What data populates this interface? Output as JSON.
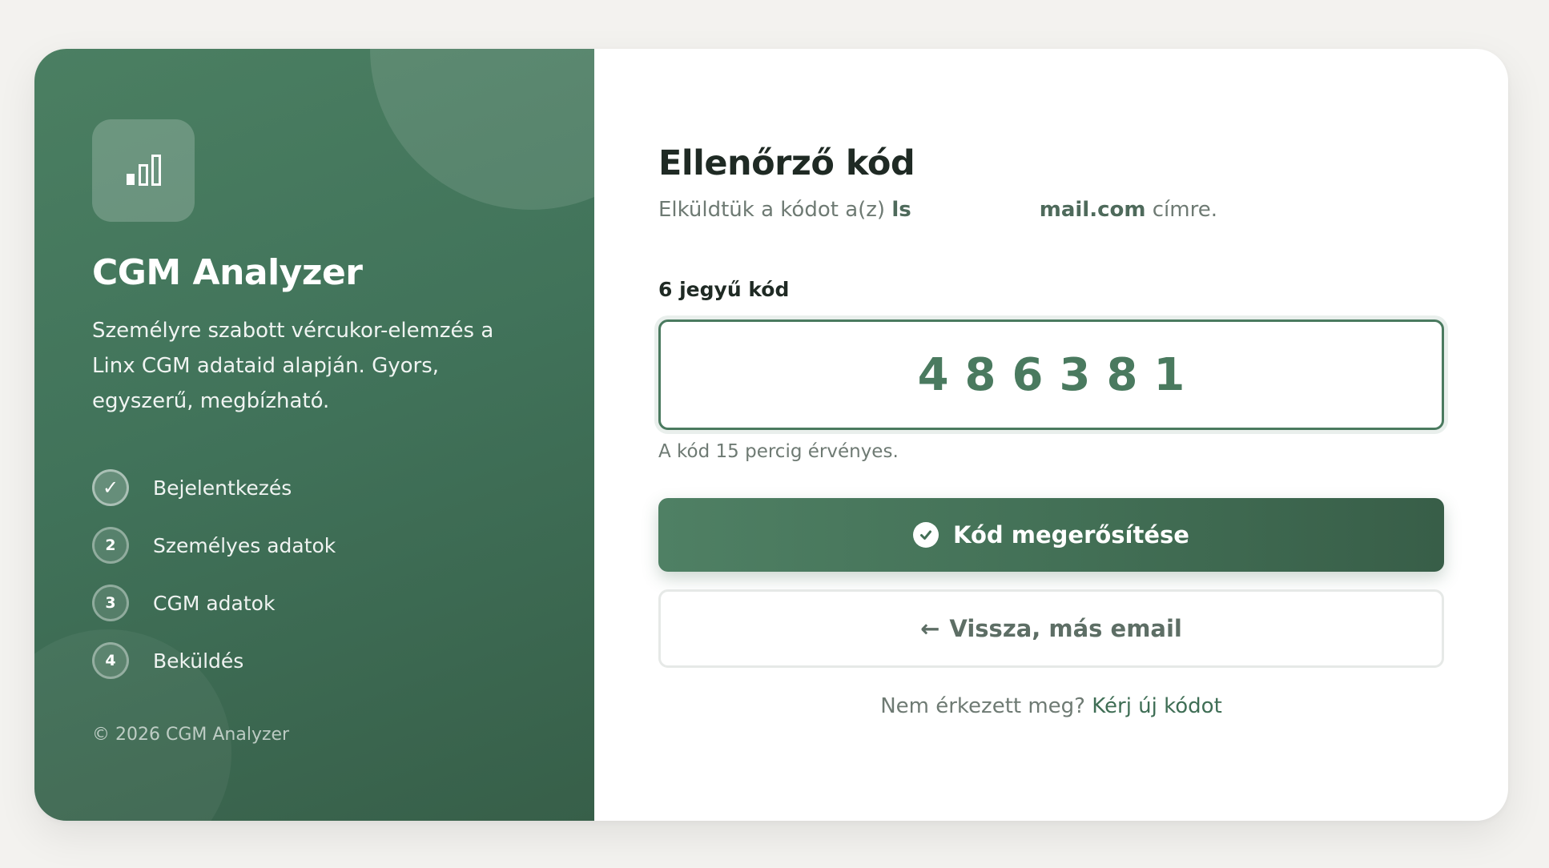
{
  "brand": {
    "app_name": "CGM Analyzer",
    "logo_icon": "bar-chart-icon",
    "tagline": "Személyre szabott vércukor-elemzés a Linx CGM adataid alapján. Gyors, egyszerű, megbízható.",
    "copyright": "© 2026 CGM Analyzer"
  },
  "steps": [
    {
      "marker": "✓",
      "label": "Bejelentkezés",
      "state": "done"
    },
    {
      "marker": "2",
      "label": "Személyes adatok",
      "state": "pending"
    },
    {
      "marker": "3",
      "label": "CGM adatok",
      "state": "pending"
    },
    {
      "marker": "4",
      "label": "Beküldés",
      "state": "pending"
    }
  ],
  "verify": {
    "title": "Ellenőrző kód",
    "subtitle_prefix": "Elküldtük a kódot a(z)",
    "email_start": "ls",
    "email_end": "mail.com",
    "subtitle_suffix": "címre.",
    "field_label": "6 jegyű kód",
    "code_value": "486381",
    "hint": "A kód 15 percig érvényes.",
    "confirm_button": "Kód megerősítése",
    "confirm_icon": "check-circle-icon",
    "back_arrow": "←",
    "back_button": "Vissza, más email",
    "resend_prefix": "Nem érkezett meg?",
    "resend_link": "Kérj új kódot"
  },
  "colors": {
    "primary": "#4a7a5f",
    "primary_dark": "#385e48",
    "text_dark": "#1f2a24",
    "text_muted": "#6e7a73",
    "background": "#f3f2ef"
  }
}
